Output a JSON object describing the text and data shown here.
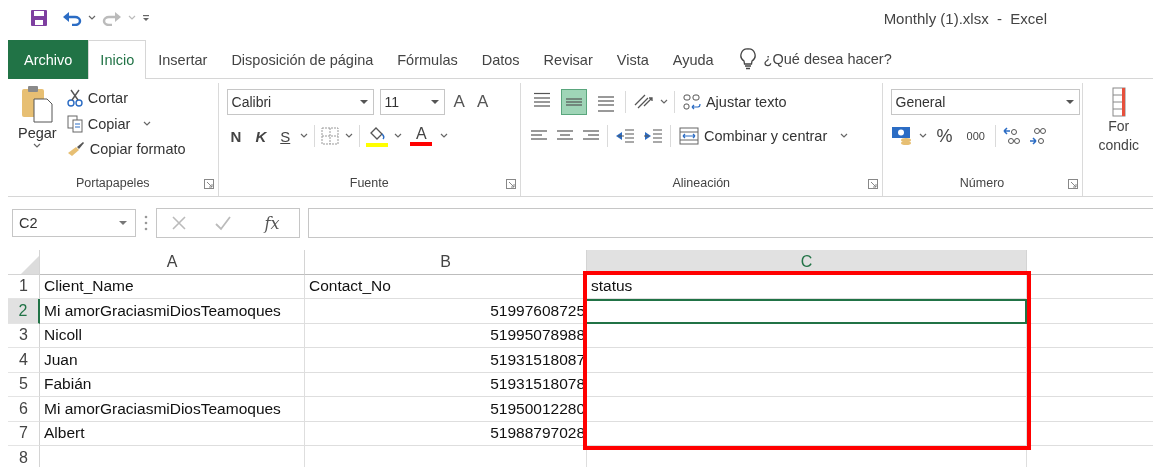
{
  "window": {
    "title": "Monthly (1).xlsx  -  Excel"
  },
  "tabs": [
    {
      "label": "Archivo",
      "kind": "file",
      "selected": false
    },
    {
      "label": "Inicio",
      "kind": "tab",
      "selected": true
    },
    {
      "label": "Insertar",
      "kind": "tab",
      "selected": false
    },
    {
      "label": "Disposición de página",
      "kind": "tab",
      "selected": false
    },
    {
      "label": "Fórmulas",
      "kind": "tab",
      "selected": false
    },
    {
      "label": "Datos",
      "kind": "tab",
      "selected": false
    },
    {
      "label": "Revisar",
      "kind": "tab",
      "selected": false
    },
    {
      "label": "Vista",
      "kind": "tab",
      "selected": false
    },
    {
      "label": "Ayuda",
      "kind": "tab",
      "selected": false
    }
  ],
  "tell_me": {
    "placeholder": "¿Qué desea hacer?"
  },
  "ribbon": {
    "clipboard": {
      "paste": "Pegar",
      "cut": "Cortar",
      "copy": "Copiar",
      "format_painter": "Copiar formato",
      "label": "Portapapeles"
    },
    "font": {
      "family": "Calibri",
      "size": "11",
      "grow": "A",
      "shrink": "A",
      "bold": "N",
      "italic": "K",
      "underline": "S",
      "font_color": "A",
      "label": "Fuente"
    },
    "alignment": {
      "vertical": [
        {
          "kind": "top",
          "selected": false
        },
        {
          "kind": "middle",
          "selected": true
        },
        {
          "kind": "bottom",
          "selected": false
        }
      ],
      "wrap": "Ajustar texto",
      "merge": "Combinar y centrar",
      "label": "Alineación"
    },
    "number": {
      "format": "General",
      "percent": "%",
      "thousands": "000",
      "label": "Número"
    },
    "styles": {
      "conditional": [
        "For",
        "condic"
      ]
    }
  },
  "formula_bar": {
    "name_box": "C2",
    "function": "fx"
  },
  "sheet": {
    "columns": [
      {
        "label": "A",
        "selected": false,
        "annotated": false
      },
      {
        "label": "B",
        "selected": false,
        "annotated": false
      },
      {
        "label": "C",
        "selected": true,
        "annotated": true
      }
    ],
    "rows": [
      {
        "header": "1",
        "selected": false,
        "cells": [
          "Client_Name",
          "Contact_No",
          "status"
        ]
      },
      {
        "header": "2",
        "selected": true,
        "cells": [
          "Mi amorGraciasmiDiosTeamoques",
          "51997608725",
          ""
        ]
      },
      {
        "header": "3",
        "selected": false,
        "cells": [
          "Nicoll",
          "51995078988",
          ""
        ]
      },
      {
        "header": "4",
        "selected": false,
        "cells": [
          "Juan",
          "51931518087",
          ""
        ]
      },
      {
        "header": "5",
        "selected": false,
        "cells": [
          "Fabián",
          "51931518078",
          ""
        ]
      },
      {
        "header": "6",
        "selected": false,
        "cells": [
          "Mi amorGraciasmiDiosTeamoques",
          "51950012280",
          ""
        ]
      },
      {
        "header": "7",
        "selected": false,
        "cells": [
          "Albert",
          "51988797028",
          ""
        ]
      },
      {
        "header": "8",
        "selected": false,
        "cells": [
          "",
          "",
          ""
        ]
      }
    ]
  },
  "annotation": {
    "kind": "rectangle",
    "color": "#ff0000"
  }
}
